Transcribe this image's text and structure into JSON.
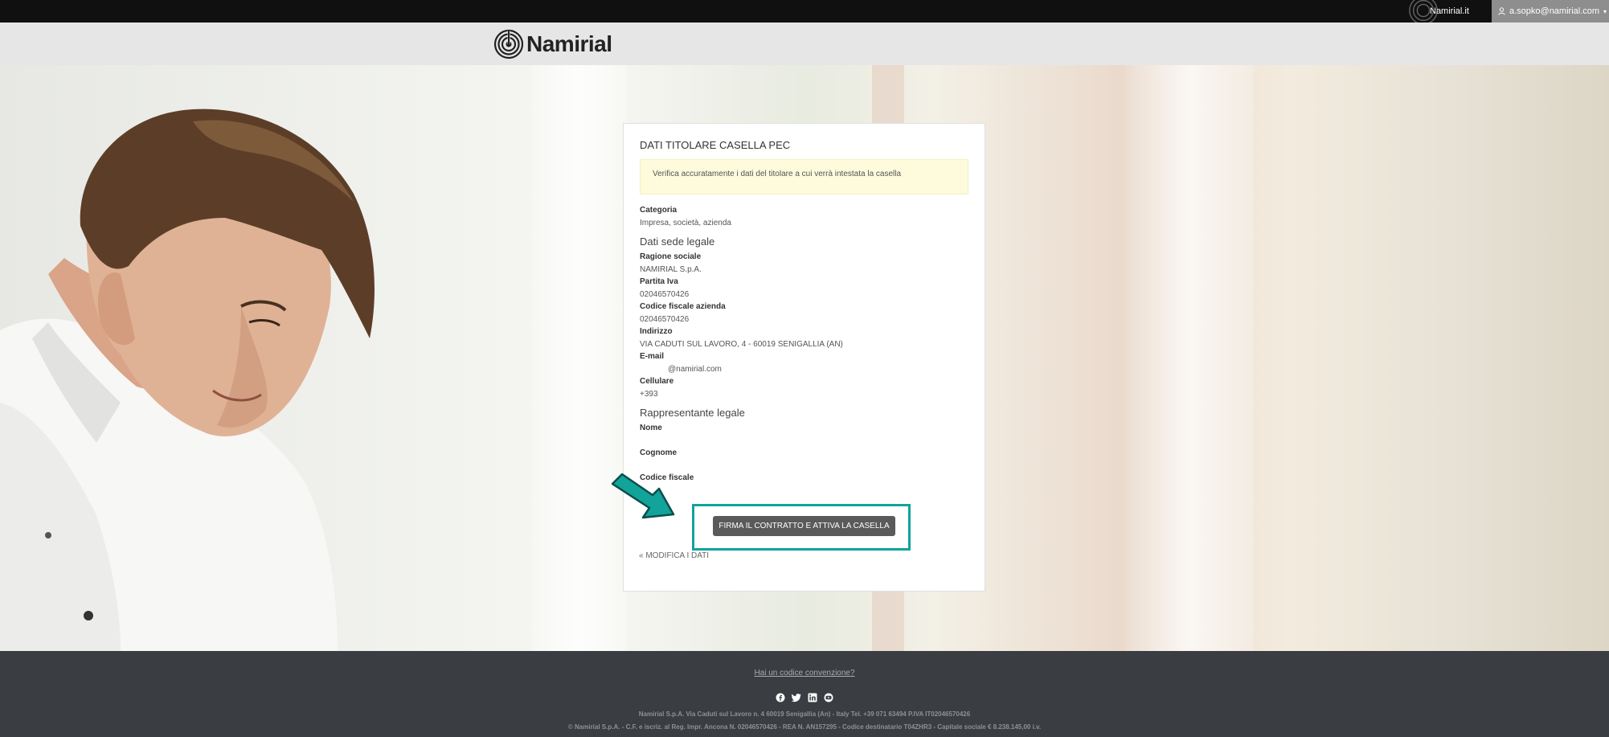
{
  "topbar": {
    "site_link": "Namirial.it",
    "user_email": "a.sopko@namirial.com"
  },
  "brand": {
    "logo_text": "Namirial"
  },
  "card": {
    "title": "DATI TITOLARE CASELLA PEC",
    "notice": "Verifica accuratamente i dati del titolare a cui verrà intestata la casella",
    "categoria_label": "Categoria",
    "categoria_value": "Impresa, società, azienda",
    "sede_heading": "Dati sede legale",
    "ragione_label": "Ragione sociale",
    "ragione_value": "NAMIRIAL S.p.A.",
    "piva_label": "Partita Iva",
    "piva_value": "02046570426",
    "cf_azienda_label": "Codice fiscale azienda",
    "cf_azienda_value": "02046570426",
    "indirizzo_label": "Indirizzo",
    "indirizzo_value": "VIA CADUTI SUL LAVORO, 4 - 60019 SENIGALLIA (AN)",
    "email_label": "E-mail",
    "email_value": "@namirial.com",
    "cellulare_label": "Cellulare",
    "cellulare_value": "+393",
    "rapp_heading": "Rappresentante legale",
    "nome_label": "Nome",
    "cognome_label": "Cognome",
    "cf_label": "Codice fiscale",
    "cta_label": "FIRMA IL CONTRATTO E ATTIVA LA CASELLA",
    "back_link": "« MODIFICA I DATI"
  },
  "footer": {
    "convention_link": "Hai un codice convenzione?",
    "social_icons": [
      "facebook-icon",
      "twitter-icon",
      "linkedin-icon",
      "youtube-icon"
    ],
    "legal_line1": "Namirial S.p.A. Via Caduti sul Lavoro n. 4 60019 Senigallia (An) - Italy Tel. +39 071 63494 P.IVA IT02046570426",
    "legal_line2": "© Namirial S.p.A. - C.F. e iscriz. al Reg. Impr. Ancona N. 02046570426 - REA N. AN157295 - Codice destinatario T04ZHR3 - Capitale sociale € 8.238.145,00 i.v."
  },
  "colors": {
    "topbar": "#101010",
    "accent_teal": "#12a39a",
    "button": "#5a5a5a",
    "footer": "#3a3d42",
    "notice_bg": "#fdfbdc"
  }
}
